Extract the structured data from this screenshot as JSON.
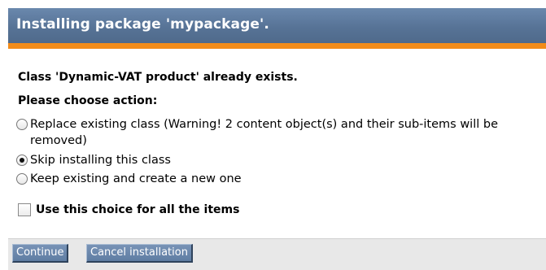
{
  "dialog": {
    "title": "Installing package 'mypackage'."
  },
  "message": {
    "exists": "Class 'Dynamic-VAT product' already exists.",
    "choose": "Please choose action:"
  },
  "options": [
    {
      "label": "Replace existing class (Warning! 2 content object(s) and their sub-items will be removed)",
      "selected": false
    },
    {
      "label": "Skip installing this class",
      "selected": true
    },
    {
      "label": "Keep existing and create a new one",
      "selected": false
    }
  ],
  "apply_all": {
    "label": "Use this choice for all the items",
    "checked": false
  },
  "buttons": {
    "continue": "Continue",
    "cancel": "Cancel installation"
  },
  "colors": {
    "title_bar": "#577396",
    "accent_stripe": "#f28c1a",
    "button": "#6a86ab"
  }
}
